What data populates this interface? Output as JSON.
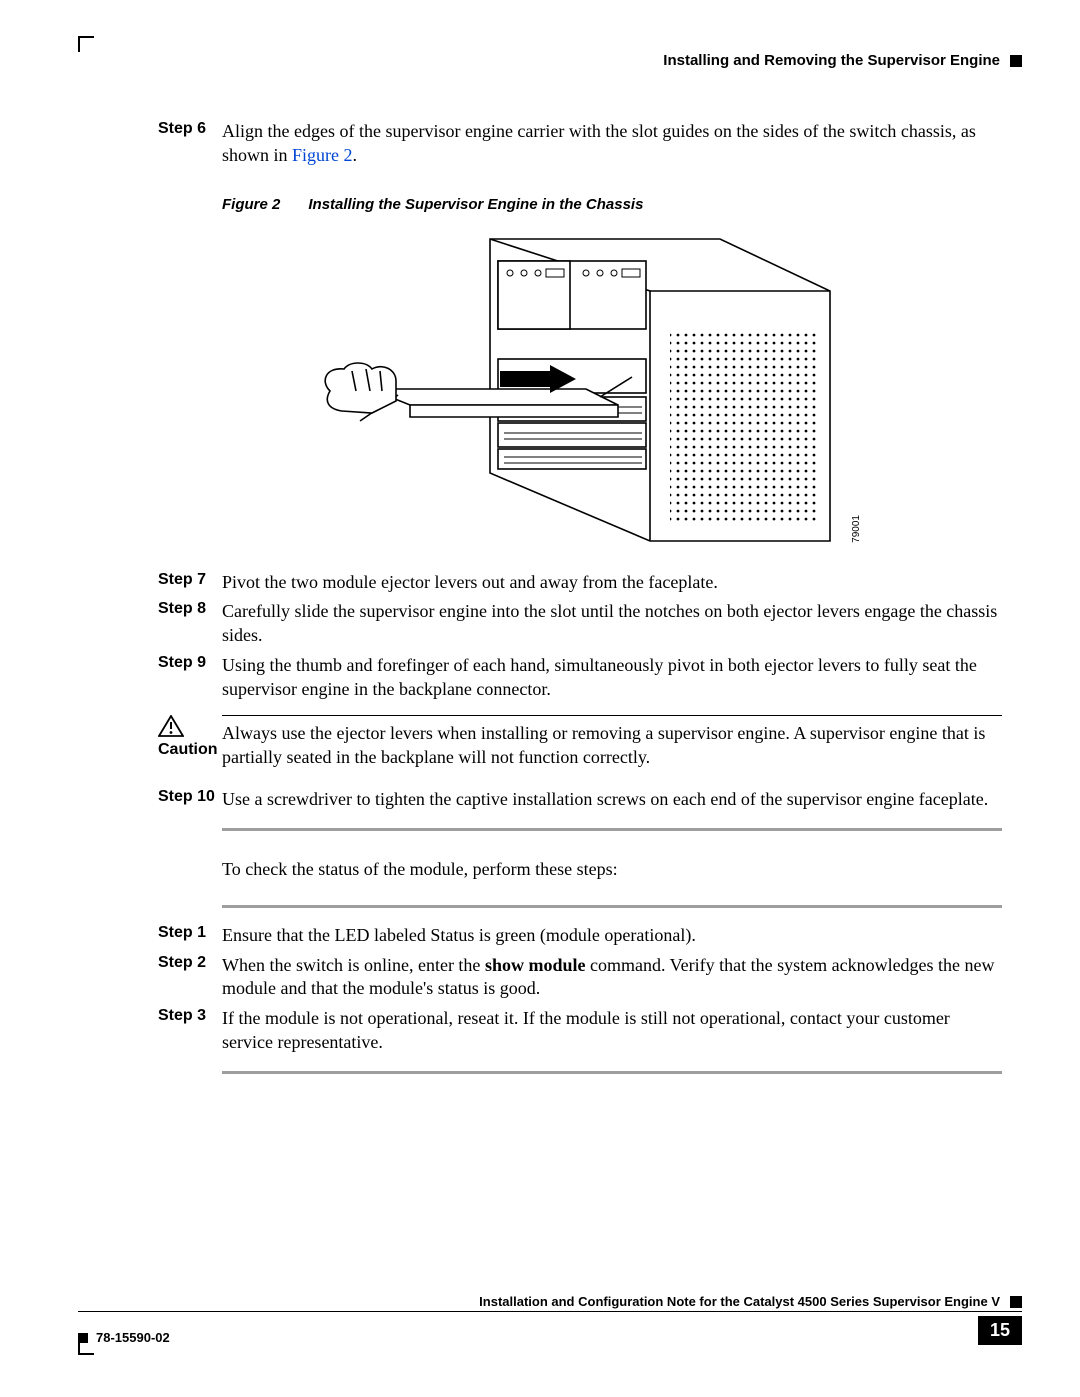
{
  "header": {
    "section": "Installing and Removing the Supervisor Engine"
  },
  "stepsA": [
    {
      "label": "Step 6",
      "text_pre": "Align the edges of the supervisor engine carrier with the slot guides on the sides of the switch chassis, as shown in ",
      "link": "Figure 2",
      "text_post": "."
    }
  ],
  "figure": {
    "label": "Figure 2",
    "caption": "Installing the Supervisor Engine in the Chassis",
    "tag": "79001"
  },
  "stepsB": [
    {
      "label": "Step 7",
      "text": "Pivot the two module ejector levers out and away from the faceplate."
    },
    {
      "label": "Step 8",
      "text": "Carefully slide the supervisor engine into the slot until the notches on both ejector levers engage the chassis sides."
    },
    {
      "label": "Step 9",
      "text": "Using the thumb and forefinger of each hand, simultaneously pivot in both ejector levers to fully seat the supervisor engine in the backplane connector."
    }
  ],
  "caution": {
    "label": "Caution",
    "text": "Always use the ejector levers when installing or removing a supervisor engine. A supervisor engine that is partially seated in the backplane will not function correctly."
  },
  "stepsC": [
    {
      "label": "Step 10",
      "text": "Use a screwdriver to tighten the captive installation screws on each end of the supervisor engine faceplate."
    }
  ],
  "midText": "To check the status of the module, perform these steps:",
  "stepsD": [
    {
      "label": "Step 1",
      "text": "Ensure that the LED labeled Status is green (module operational)."
    },
    {
      "label": "Step 2",
      "pre": "When the switch is online, enter the ",
      "bold": "show module",
      "post": " command. Verify that the system acknowledges the new module and that the module's status is good."
    },
    {
      "label": "Step 3",
      "text": "If the module is not operational, reseat it. If the module is still not operational, contact your customer service representative."
    }
  ],
  "footer": {
    "title": "Installation and Configuration Note for the Catalyst 4500 Series Supervisor Engine V",
    "docnum": "78-15590-02",
    "page": "15"
  }
}
